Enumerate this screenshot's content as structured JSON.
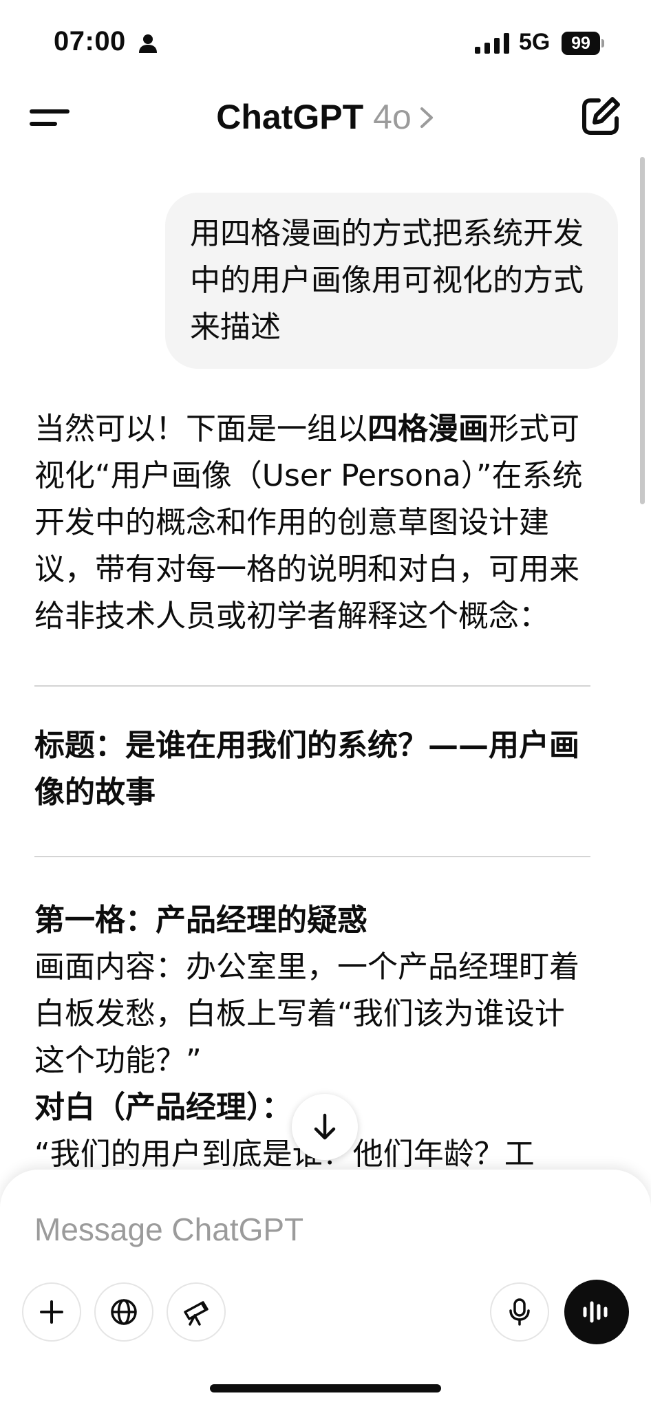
{
  "status_bar": {
    "time": "07:00",
    "network": "5G",
    "battery": "99"
  },
  "header": {
    "title": "ChatGPT",
    "model": "4o"
  },
  "user_message": "用四格漫画的方式把系统开发中的用户画像用可视化的方式来描述",
  "assistant": {
    "intro_a": "当然可以！下面是一组以",
    "intro_bold": "四格漫画",
    "intro_b": "形式可视化“用户画像（User Persona）”在系统开发中的概念和作用的创意草图设计建议，带有对每一格的说明和对白，可用来给非技术人员或初学者解释这个概念：",
    "section_title": "标题：是谁在用我们的系统？——用户画像的故事",
    "panel1": {
      "heading": "第一格：产品经理的疑惑",
      "content": "画面内容：办公室里，一个产品经理盯着白板发愁，白板上写着“我们该为谁设计这个功能？”",
      "dialog_label": "对白（产品经理）：",
      "dialog_text": "“我们的用户到底是谁？他们年龄？工"
    }
  },
  "composer": {
    "placeholder": "Message ChatGPT"
  }
}
